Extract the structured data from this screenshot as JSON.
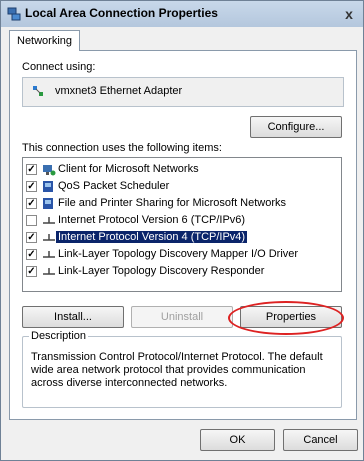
{
  "window": {
    "title": "Local Area Connection Properties",
    "close_label": "x"
  },
  "tabs": [
    {
      "label": "Networking"
    }
  ],
  "connect_using": {
    "label": "Connect using:",
    "adapter_name": "vmxnet3 Ethernet Adapter",
    "configure_label": "Configure..."
  },
  "items_label": "This connection uses the following items:",
  "items": [
    {
      "label": "Client for Microsoft Networks",
      "checked": true,
      "icon": "network-client-icon"
    },
    {
      "label": "QoS Packet Scheduler",
      "checked": true,
      "icon": "network-service-icon"
    },
    {
      "label": "File and Printer Sharing for Microsoft Networks",
      "checked": true,
      "icon": "network-service-icon"
    },
    {
      "label": "Internet Protocol Version 6 (TCP/IPv6)",
      "checked": false,
      "icon": "protocol-icon"
    },
    {
      "label": "Internet Protocol Version 4 (TCP/IPv4)",
      "checked": true,
      "icon": "protocol-icon",
      "selected": true
    },
    {
      "label": "Link-Layer Topology Discovery Mapper I/O Driver",
      "checked": true,
      "icon": "protocol-icon"
    },
    {
      "label": "Link-Layer Topology Discovery Responder",
      "checked": true,
      "icon": "protocol-icon"
    }
  ],
  "buttons": {
    "install": "Install...",
    "uninstall": "Uninstall",
    "properties": "Properties"
  },
  "description": {
    "legend": "Description",
    "text": "Transmission Control Protocol/Internet Protocol. The default wide area network protocol that provides communication across diverse interconnected networks."
  },
  "footer": {
    "ok": "OK",
    "cancel": "Cancel"
  },
  "colors": {
    "selection": "#0a246a",
    "highlight_ring": "#dd2222"
  }
}
